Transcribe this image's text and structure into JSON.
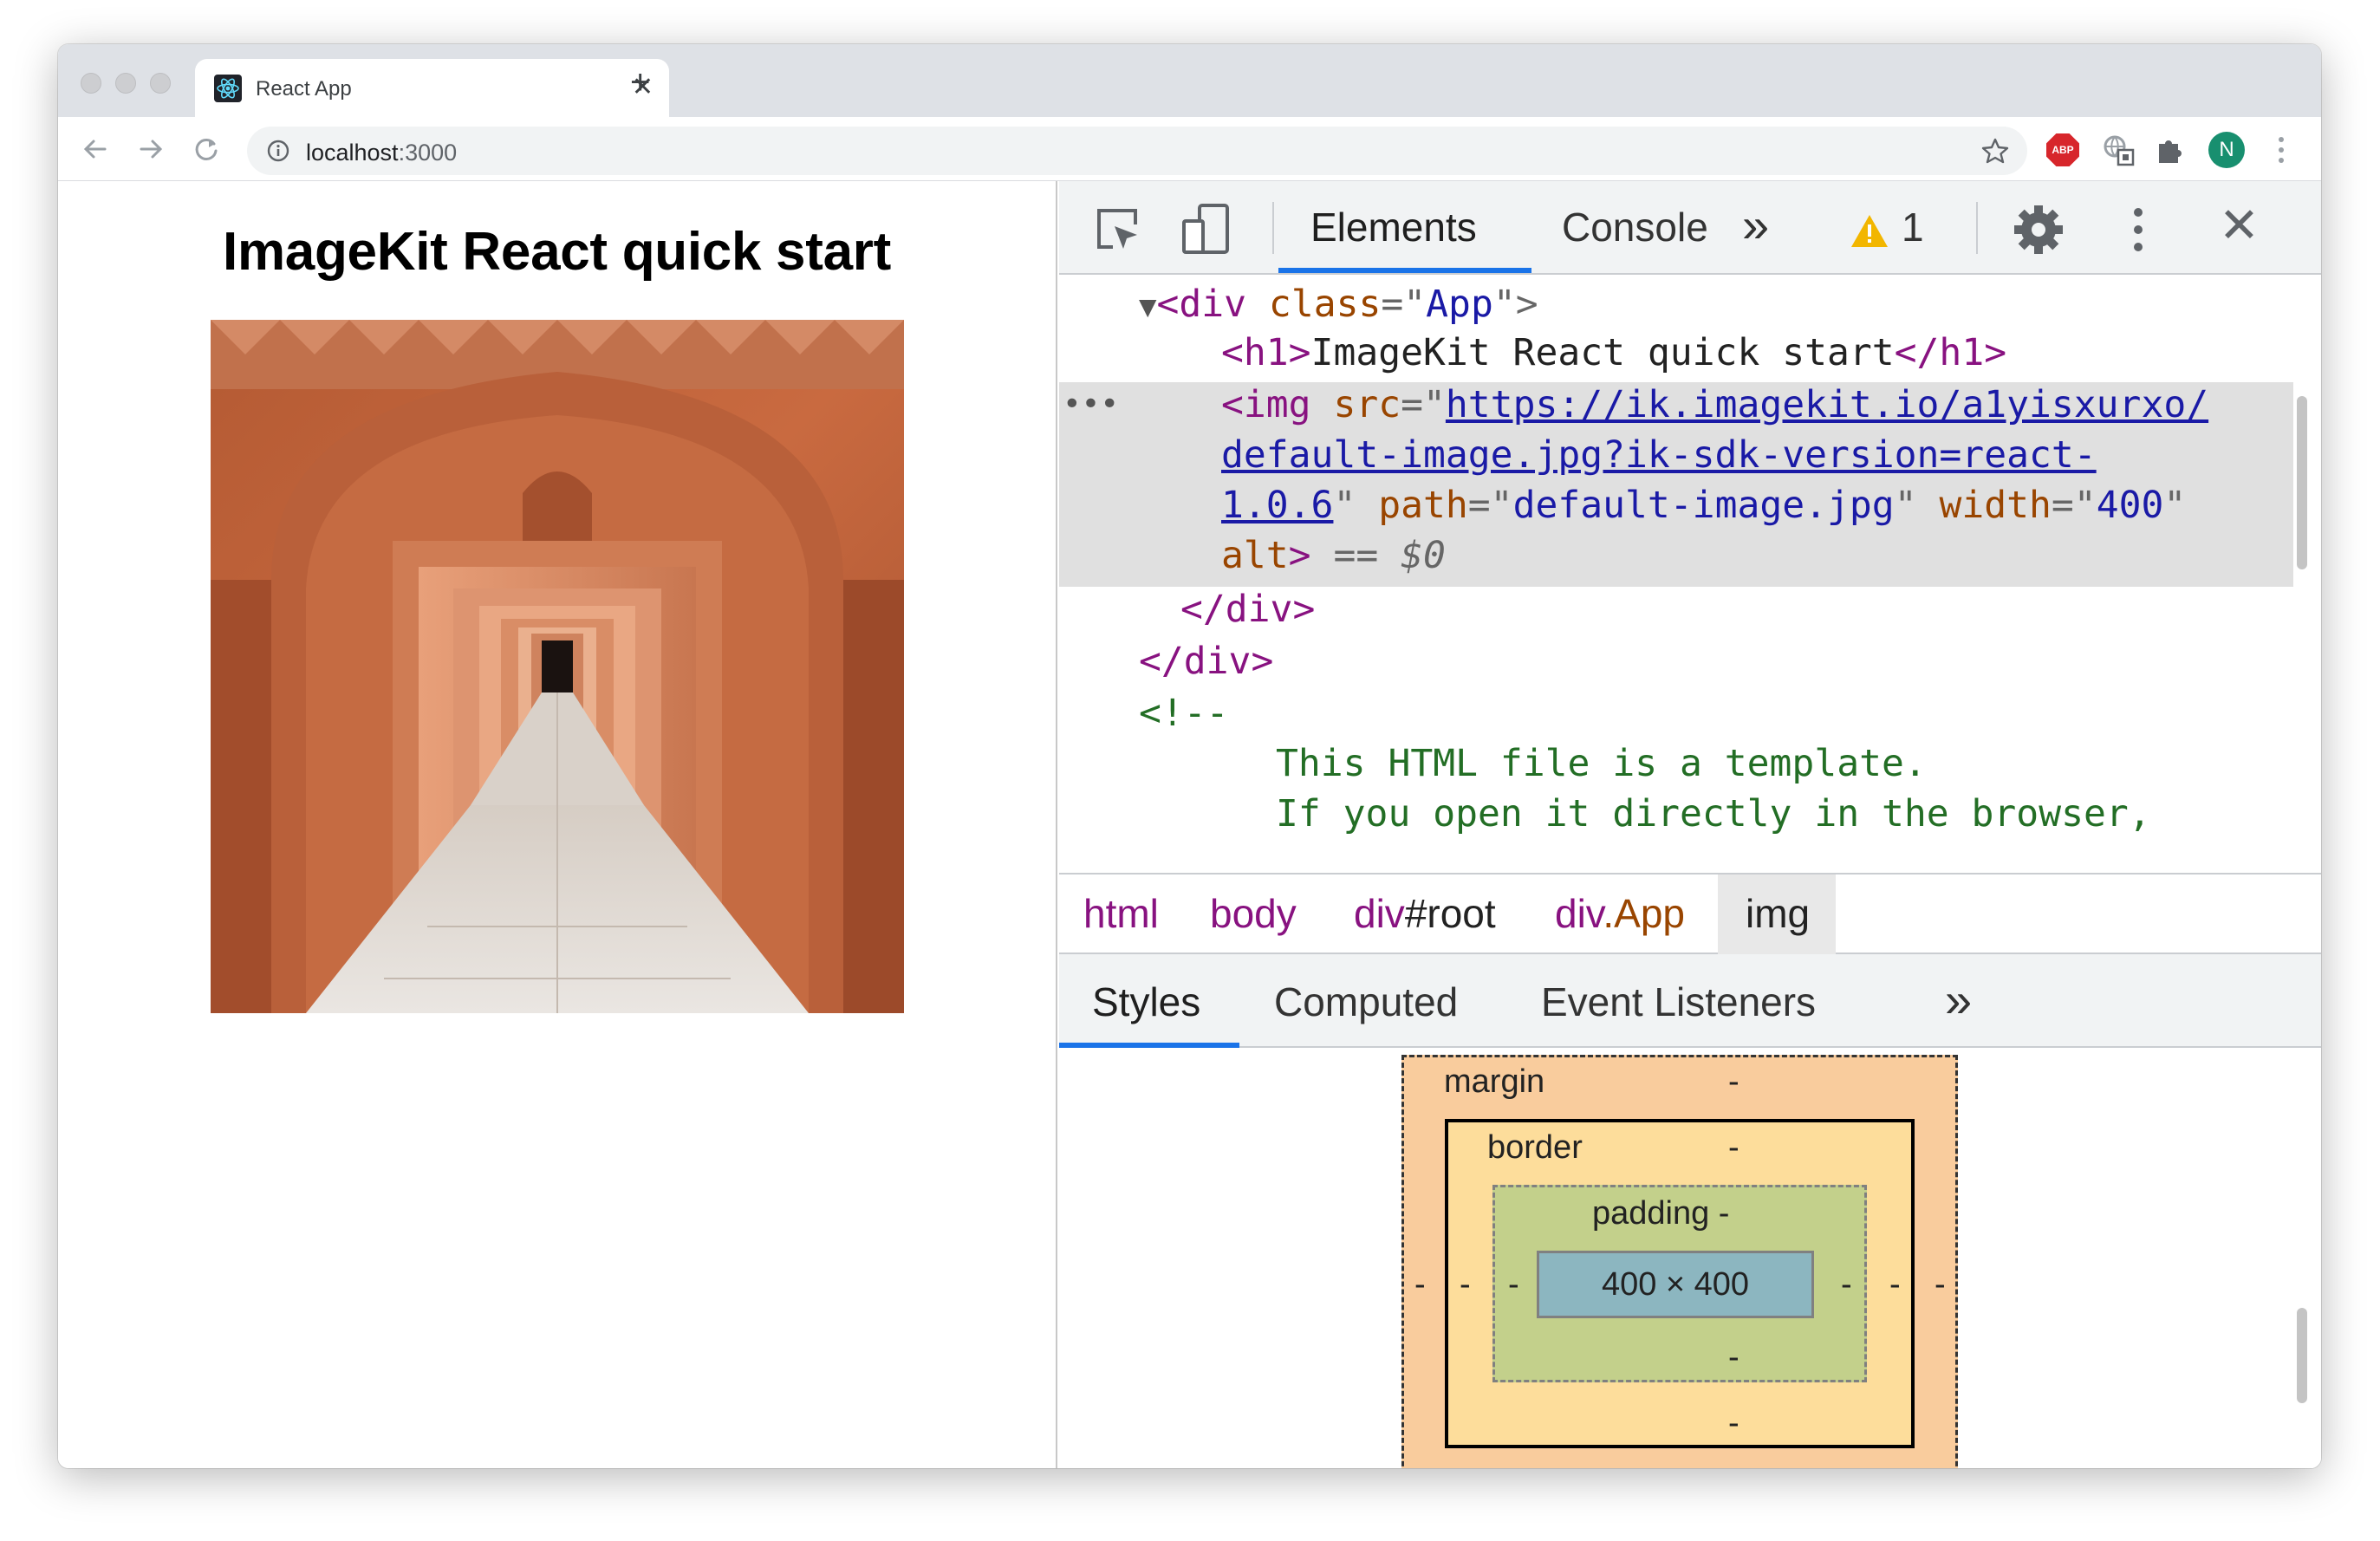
{
  "tab": {
    "title": "React App",
    "close": "✕",
    "new_tab": "+"
  },
  "address": {
    "host": "localhost",
    "port": ":3000"
  },
  "extensions": {
    "abp": "ABP",
    "avatar": "N"
  },
  "page": {
    "heading": "ImageKit React quick start"
  },
  "devtools": {
    "tabs": {
      "elements": "Elements",
      "console": "Console",
      "more": "»"
    },
    "warnings": {
      "count": "1"
    },
    "close": "✕",
    "dom": {
      "l1_tag_open": "<div",
      "l1_attr": " class",
      "l1_eq": "=\"",
      "l1_val": "App",
      "l1_end": "\">",
      "l2_open": "<h1>",
      "l2_text": "ImageKit React quick start",
      "l2_close": "</h1>",
      "l3_open": "<img",
      "l3_attr": " src",
      "l3_eq": "=\"",
      "l3_link": "https://ik.imagekit.io/a1yisxurxo/",
      "l4_link": "default-image.jpg?ik-sdk-version=react-",
      "l5_link": "1.0.6",
      "l5_q": "\"",
      "l5_attr1": " path",
      "l5_eq1": "=\"",
      "l5_val1": "default-image.jpg",
      "l5_q1": "\"",
      "l5_attr2": " width",
      "l5_eq2": "=\"",
      "l5_val2": "400",
      "l5_q2": "\"",
      "l6_attr": "alt",
      "l6_end": ">",
      "l6_eq": " == ",
      "l6_sel": "$0",
      "l7": "</div>",
      "l8": "</div>",
      "l9": "<!--",
      "l10": "This HTML file is a template.",
      "l11": "If you open it directly in the browser,",
      "ellipsis": "•••"
    },
    "breadcrumbs": {
      "html": "html",
      "body": "body",
      "root_tag": "div",
      "root_id": "#root",
      "app_tag": "div",
      "app_class": ".App",
      "img": "img"
    },
    "subtabs": {
      "styles": "Styles",
      "computed": "Computed",
      "listeners": "Event Listeners",
      "more": "»"
    },
    "box_model": {
      "margin_label": "margin",
      "margin_top": "-",
      "margin_left": "-",
      "margin_right": "-",
      "border_label": "border",
      "border_top": "-",
      "border_left": "-",
      "border_right": "-",
      "border_bottom": "-",
      "padding_label": "padding -",
      "padding_left": "-",
      "padding_right": "-",
      "padding_bottom": "-",
      "content": "400 × 400"
    }
  }
}
